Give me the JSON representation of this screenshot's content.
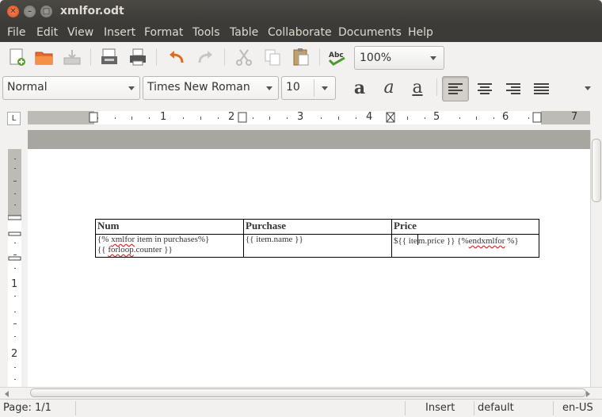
{
  "window": {
    "title": "xmlfor.odt"
  },
  "menu": [
    "File",
    "Edit",
    "View",
    "Insert",
    "Format",
    "Tools",
    "Table",
    "Collaborate",
    "Documents",
    "Help"
  ],
  "toolbar": {
    "zoom": "100%",
    "spell_label": "Abc"
  },
  "format_toolbar": {
    "style": "Normal",
    "font": "Times New Roman",
    "size": "10"
  },
  "ruler": {
    "h_numbers": [
      "1",
      "2",
      "3",
      "4",
      "5",
      "6",
      "7"
    ],
    "v_numbers": [
      "1",
      "2"
    ]
  },
  "table": {
    "headers": [
      "Num",
      "Purchase",
      "Price"
    ],
    "row": {
      "c1_a": "{% ",
      "c1_b": "xmlfor",
      "c1_c": " item in purchases%}",
      "c1_d": "{{ ",
      "c1_e": "forloop",
      "c1_f": ".counter }}",
      "c2": "{{ item.name }}",
      "c3_a": "${{ ite",
      "c3_b": "m.price }} {%",
      "c3_c": "endxmlfor",
      "c3_d": " %}"
    }
  },
  "status": {
    "page": "Page: 1/1",
    "mode": "Insert",
    "style": "default",
    "lang": "en-US"
  }
}
